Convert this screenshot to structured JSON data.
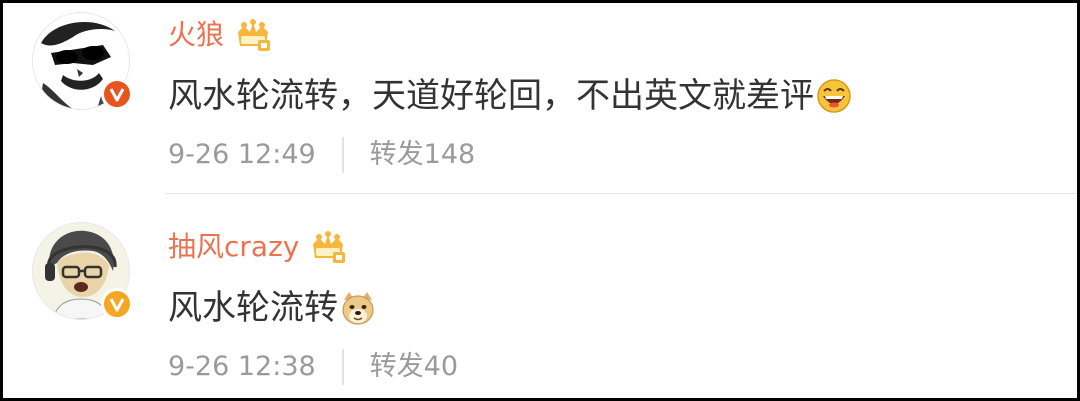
{
  "comments": [
    {
      "username": "火狼",
      "text": "风水轮流转，天道好轮回，不出英文就差评",
      "emoji": "laughing-emoji",
      "time": "9-26 12:49",
      "repost": "转发148",
      "badge_color": "#e8541e"
    },
    {
      "username": "抽风crazy",
      "text": "风水轮流转",
      "emoji": "doge-emoji",
      "time": "9-26 12:38",
      "repost": "转发40",
      "badge_color": "#f5a623"
    }
  ],
  "colors": {
    "username": "#eb7350",
    "text": "#333333",
    "meta": "#9a9a9a",
    "crown": "#f6b73c"
  }
}
